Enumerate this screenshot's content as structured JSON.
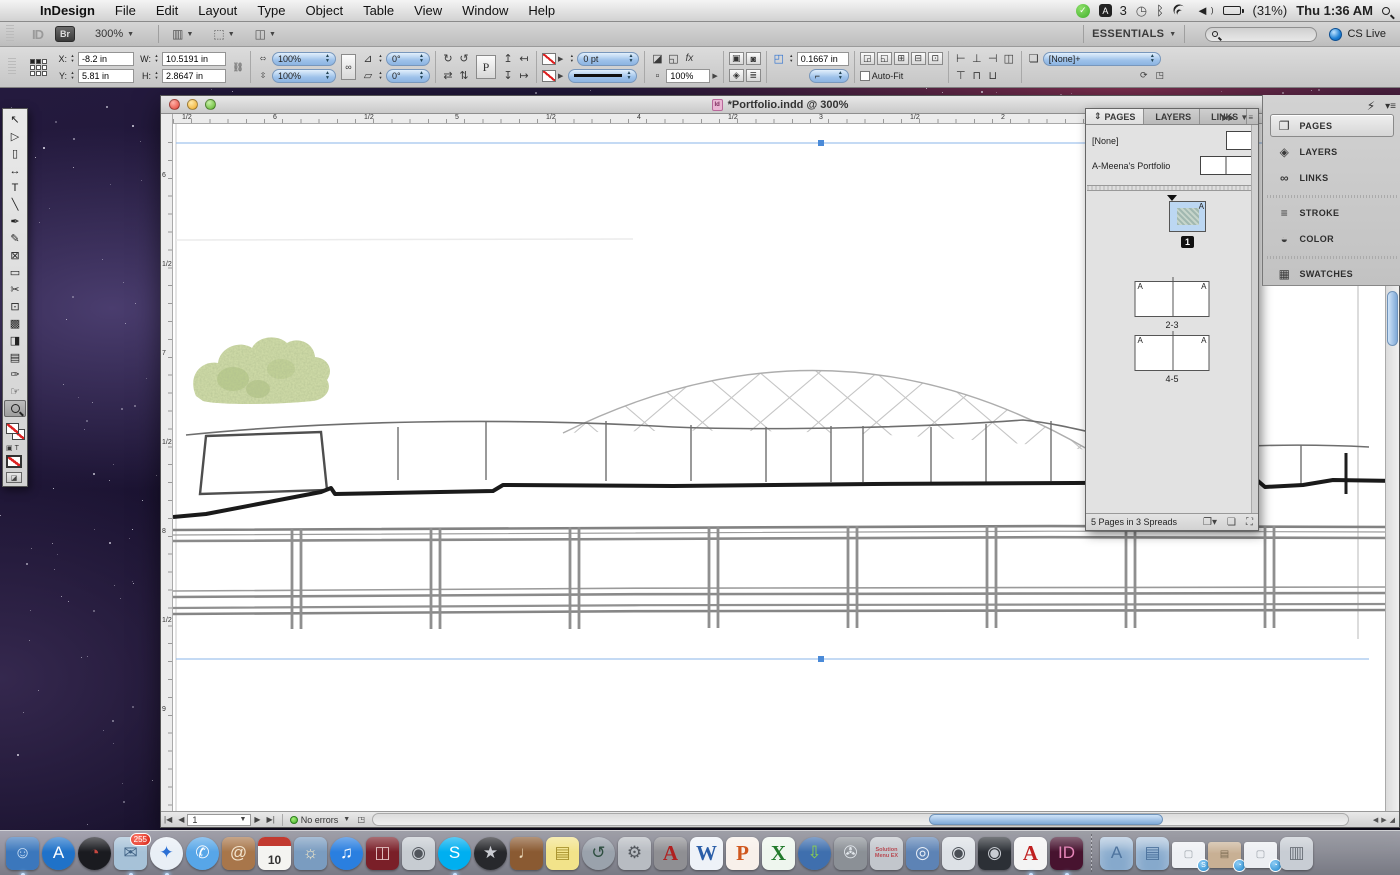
{
  "menu_bar": {
    "apple_icon": "",
    "items": [
      {
        "label": "InDesign",
        "bold": "true"
      },
      {
        "label": "File"
      },
      {
        "label": "Edit"
      },
      {
        "label": "Layout"
      },
      {
        "label": "Type"
      },
      {
        "label": "Object"
      },
      {
        "label": "Table"
      },
      {
        "label": "View"
      },
      {
        "label": "Window"
      },
      {
        "label": "Help"
      }
    ],
    "input_source_count": "3",
    "battery": "(31%)",
    "clock": "Thu 1:36 AM"
  },
  "app_bar": {
    "logo": "ID",
    "bridge_label": "Br",
    "zoom_level": "300%",
    "workspace": "ESSENTIALS",
    "cs_live": "CS Live",
    "search_placeholder": ""
  },
  "control_panel": {
    "x_label": "X:",
    "x_value": "-8.2 in",
    "y_label": "Y:",
    "y_value": "5.81 in",
    "w_label": "W:",
    "w_value": "10.5191 in",
    "h_label": "H:",
    "h_value": "2.8647 in",
    "scale_x": "100%",
    "scale_y": "100%",
    "rotation": "0°",
    "shear": "0°",
    "content_indicator": "P",
    "stroke_weight": "0 pt",
    "opacity": "100%",
    "effects_label": "fx",
    "corner_radius": "0.1667 in",
    "autofit_label": "Auto-Fit",
    "object_style": "[None]+"
  },
  "window": {
    "title": "*Portfolio.indd @ 300%",
    "doc_icon_label": "Id",
    "page_number": "1",
    "preflight_status": "No errors"
  },
  "rulers": {
    "top": [
      "1/2",
      "6",
      "1/2",
      "5",
      "1/2",
      "4",
      "1/2",
      "3",
      "1/2",
      "2"
    ],
    "left": [
      "6",
      "1/2",
      "7",
      "1/2",
      "8",
      "1/2",
      "9"
    ]
  },
  "pages_panel": {
    "tabs": [
      {
        "label": "PAGES",
        "active": "true",
        "icon": "⇕"
      },
      {
        "label": "LAYERS"
      },
      {
        "label": "LINKS"
      }
    ],
    "masters": [
      {
        "name": "[None]"
      },
      {
        "name": "A-Meena's Portfolio"
      }
    ],
    "master_letter": "A",
    "spreads": [
      {
        "label": "1",
        "selected": true
      },
      {
        "label": "2-3"
      },
      {
        "label": "4-5"
      }
    ],
    "footer": "5 Pages in 3 Spreads"
  },
  "side_dock": {
    "items": [
      {
        "label": "PAGES",
        "icon": "❐",
        "active": "true"
      },
      {
        "label": "LAYERS",
        "icon": "◈"
      },
      {
        "label": "LINKS",
        "icon": "∞"
      },
      {
        "label": "STROKE",
        "icon": "≡",
        "gap": "true"
      },
      {
        "label": "COLOR",
        "icon": "◒"
      },
      {
        "label": "SWATCHES",
        "icon": "▦",
        "gap": "true"
      }
    ]
  },
  "tools": [
    {
      "name": "selection-tool",
      "glyph": "↖"
    },
    {
      "name": "direct-selection-tool",
      "glyph": "▷"
    },
    {
      "name": "page-tool",
      "glyph": "▯"
    },
    {
      "name": "gap-tool",
      "glyph": "↔"
    },
    {
      "name": "type-tool",
      "glyph": "T"
    },
    {
      "name": "line-tool",
      "glyph": "╲"
    },
    {
      "name": "pen-tool",
      "glyph": "✒"
    },
    {
      "name": "pencil-tool",
      "glyph": "✎"
    },
    {
      "name": "frame-tool",
      "glyph": "⊠"
    },
    {
      "name": "rectangle-tool",
      "glyph": "▭"
    },
    {
      "name": "scissors-tool",
      "glyph": "✂"
    },
    {
      "name": "free-transform-tool",
      "glyph": "⊡"
    },
    {
      "name": "gradient-tool",
      "glyph": "▩"
    },
    {
      "name": "gradient-feather-tool",
      "glyph": "◨"
    },
    {
      "name": "note-tool",
      "glyph": "▤"
    },
    {
      "name": "eyedropper-tool",
      "glyph": "✑"
    },
    {
      "name": "hand-tool",
      "glyph": "☞"
    },
    {
      "name": "zoom-tool",
      "glyph": "",
      "selected": "true"
    }
  ],
  "dock": {
    "apps": [
      {
        "name": "finder",
        "glyph": "☺",
        "bg": "#3b77bc",
        "fg": "#d6e8fa",
        "running": "true"
      },
      {
        "name": "app-store",
        "glyph": "A",
        "bg": "#1f72c9",
        "fg": "#ffffff",
        "shape": "circle"
      },
      {
        "name": "dashboard",
        "glyph": "◔",
        "bg": "#1a1b20",
        "fg": "#c84840",
        "shape": "circle"
      },
      {
        "name": "mail",
        "glyph": "✉",
        "bg": "#a7c2d8",
        "fg": "#3f6184",
        "badge": "255",
        "running": "true"
      },
      {
        "name": "safari",
        "glyph": "✦",
        "bg": "#e9eff6",
        "fg": "#2b6fd4",
        "shape": "circle",
        "running": "true"
      },
      {
        "name": "ichat",
        "glyph": "✆",
        "bg": "#57a6e8",
        "fg": "#ffffff",
        "shape": "circle"
      },
      {
        "name": "address-book",
        "glyph": "@",
        "bg": "#a8764a",
        "fg": "#f2e4ce"
      },
      {
        "name": "ical",
        "glyph": "10",
        "bg": "#f4f4f1",
        "fg": "#333333"
      },
      {
        "name": "iphoto",
        "glyph": "☼",
        "bg": "#7a9cc0",
        "fg": "#f5e9c8"
      },
      {
        "name": "itunes",
        "glyph": "♫",
        "bg": "#2a7fe0",
        "fg": "#ffffff",
        "shape": "circle"
      },
      {
        "name": "photo-booth",
        "glyph": "◫",
        "bg": "#7a1f28",
        "fg": "#e4c2c2"
      },
      {
        "name": "image-capture",
        "glyph": "◉",
        "bg": "#c7ccd2",
        "fg": "#50555c"
      },
      {
        "name": "skype",
        "glyph": "S",
        "bg": "#00aff0",
        "fg": "#ffffff",
        "shape": "circle",
        "running": "true"
      },
      {
        "name": "imovie",
        "glyph": "★",
        "bg": "#27282c",
        "fg": "#caccd2",
        "shape": "circle"
      },
      {
        "name": "garageband",
        "glyph": "♩",
        "bg": "#8a5a32",
        "fg": "#ecdcbc"
      },
      {
        "name": "stickies",
        "glyph": "▤",
        "bg": "#f2e38a",
        "fg": "#a8922e"
      },
      {
        "name": "time-machine",
        "glyph": "↺",
        "bg": "#9aa2ac",
        "fg": "#2e4e40",
        "shape": "circle"
      },
      {
        "name": "system-preferences",
        "glyph": "⚙",
        "bg": "#b8bcc2",
        "fg": "#54585e"
      },
      {
        "name": "autocad",
        "glyph": "A",
        "bg": "#8f8f93",
        "fg": "#b02020"
      },
      {
        "name": "word",
        "glyph": "W",
        "bg": "#eef2f8",
        "fg": "#2b5ea8"
      },
      {
        "name": "powerpoint",
        "glyph": "P",
        "bg": "#f8f0ea",
        "fg": "#d0571e"
      },
      {
        "name": "excel",
        "glyph": "X",
        "bg": "#eef6ee",
        "fg": "#217a2b"
      },
      {
        "name": "web-downloader",
        "glyph": "⇩",
        "bg": "#3f6fae",
        "fg": "#8fd44a",
        "shape": "circle"
      },
      {
        "name": "remote-desktop",
        "glyph": "✇",
        "bg": "#8b9096",
        "fg": "#e2e7ec"
      },
      {
        "name": "solution-menu-ex",
        "glyph": "Solution Menu EX",
        "bg": "#c2c6cc",
        "fg": "#b84a52"
      },
      {
        "name": "photo-browser",
        "glyph": "◎",
        "bg": "#5d83b5",
        "fg": "#eaf0f8"
      },
      {
        "name": "camera-utility",
        "glyph": "◉",
        "bg": "#dde1e6",
        "fg": "#4a4f56"
      },
      {
        "name": "camera-app",
        "glyph": "◉",
        "bg": "#2c3036",
        "fg": "#c8ccd2"
      },
      {
        "name": "adobe-reader",
        "glyph": "A",
        "bg": "#f4f4f4",
        "fg": "#c02020",
        "running": "true"
      },
      {
        "name": "indesign",
        "glyph": "ID",
        "bg": "#47132f",
        "fg": "#e585b8",
        "running": "true"
      }
    ],
    "items_right": [
      {
        "name": "applications-folder",
        "glyph": "A",
        "bg": "#86a9cc",
        "fg": "#4e749e",
        "folder": "true"
      },
      {
        "name": "documents-folder",
        "glyph": "▤",
        "bg": "#86a9cc",
        "fg": "#4e749e",
        "folder": "true"
      },
      {
        "name": "minimized-window-skype",
        "glyph": "▢",
        "bg": "#eef0f4",
        "fg": "#9aa0a8",
        "badge": "S"
      },
      {
        "name": "minimized-window-web",
        "glyph": "▤",
        "bg": "#c8b094",
        "fg": "#7a6a52",
        "badge": "◔"
      },
      {
        "name": "minimized-window-chat",
        "glyph": "▢",
        "bg": "#eceef2",
        "fg": "#9aa0a8",
        "badge": "◔"
      },
      {
        "name": "trash",
        "glyph": "▥",
        "bg": "#c8cdd4",
        "fg": "#6a7078"
      }
    ]
  },
  "colors": {
    "accent_blue": "#3b7fd4",
    "guide_blue": "#74a9e4",
    "selection_highlight": "#b8d4f0"
  }
}
